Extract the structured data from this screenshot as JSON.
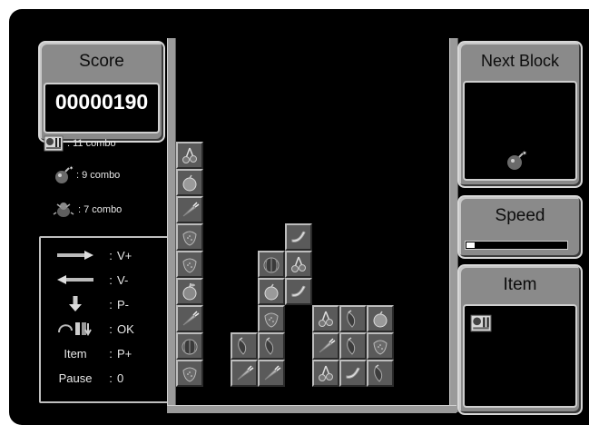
{
  "score": {
    "title": "Score",
    "value": "00000190"
  },
  "combos": [
    {
      "icon": "oil-item-icon",
      "text": ": 11 combo"
    },
    {
      "icon": "bomb-icon",
      "text": ": 9 combo"
    },
    {
      "icon": "bug-icon",
      "text": ": 7 combo"
    }
  ],
  "controls": [
    {
      "icon": "right-arrow-icon",
      "key": "",
      "sep": ":",
      "value": "V+"
    },
    {
      "icon": "left-arrow-icon",
      "key": "",
      "sep": ":",
      "value": "V-"
    },
    {
      "icon": "down-arrow-icon",
      "key": "",
      "sep": ":",
      "value": "P-"
    },
    {
      "icon": "rotate-icon",
      "key": "",
      "sep": ":",
      "value": "OK"
    },
    {
      "icon": "",
      "key": "Item",
      "sep": ":",
      "value": "P+"
    },
    {
      "icon": "",
      "key": "Pause",
      "sep": ":",
      "value": "0"
    }
  ],
  "next_block": {
    "title": "Next Block",
    "piece": "bomb-icon"
  },
  "speed": {
    "title": "Speed",
    "level": 0.08
  },
  "item": {
    "title": "Item",
    "held": "oil-item-icon"
  },
  "board": {
    "columns": 10,
    "rows": 10,
    "cells": [
      {
        "col": 0,
        "row": 1,
        "type": "cherry"
      },
      {
        "col": 0,
        "row": 2,
        "type": "peach"
      },
      {
        "col": 0,
        "row": 3,
        "type": "carrot"
      },
      {
        "col": 0,
        "row": 4,
        "type": "strawberry"
      },
      {
        "col": 0,
        "row": 5,
        "type": "strawberry"
      },
      {
        "col": 0,
        "row": 6,
        "type": "apple"
      },
      {
        "col": 0,
        "row": 7,
        "type": "carrot"
      },
      {
        "col": 0,
        "row": 8,
        "type": "watermelon"
      },
      {
        "col": 0,
        "row": 9,
        "type": "strawberry"
      },
      {
        "col": 2,
        "row": 8,
        "type": "pepper"
      },
      {
        "col": 2,
        "row": 9,
        "type": "carrot"
      },
      {
        "col": 3,
        "row": 5,
        "type": "watermelon"
      },
      {
        "col": 3,
        "row": 6,
        "type": "peach"
      },
      {
        "col": 3,
        "row": 7,
        "type": "strawberry"
      },
      {
        "col": 3,
        "row": 8,
        "type": "pepper"
      },
      {
        "col": 3,
        "row": 9,
        "type": "carrot"
      },
      {
        "col": 4,
        "row": 4,
        "type": "banana"
      },
      {
        "col": 4,
        "row": 5,
        "type": "cherry"
      },
      {
        "col": 4,
        "row": 6,
        "type": "banana"
      },
      {
        "col": 5,
        "row": 7,
        "type": "cherry"
      },
      {
        "col": 5,
        "row": 8,
        "type": "carrot"
      },
      {
        "col": 5,
        "row": 9,
        "type": "cherry"
      },
      {
        "col": 6,
        "row": 7,
        "type": "pepper"
      },
      {
        "col": 6,
        "row": 8,
        "type": "pepper"
      },
      {
        "col": 6,
        "row": 9,
        "type": "banana"
      },
      {
        "col": 7,
        "row": 7,
        "type": "peach"
      },
      {
        "col": 7,
        "row": 8,
        "type": "strawberry"
      },
      {
        "col": 7,
        "row": 9,
        "type": "pepper"
      }
    ]
  }
}
